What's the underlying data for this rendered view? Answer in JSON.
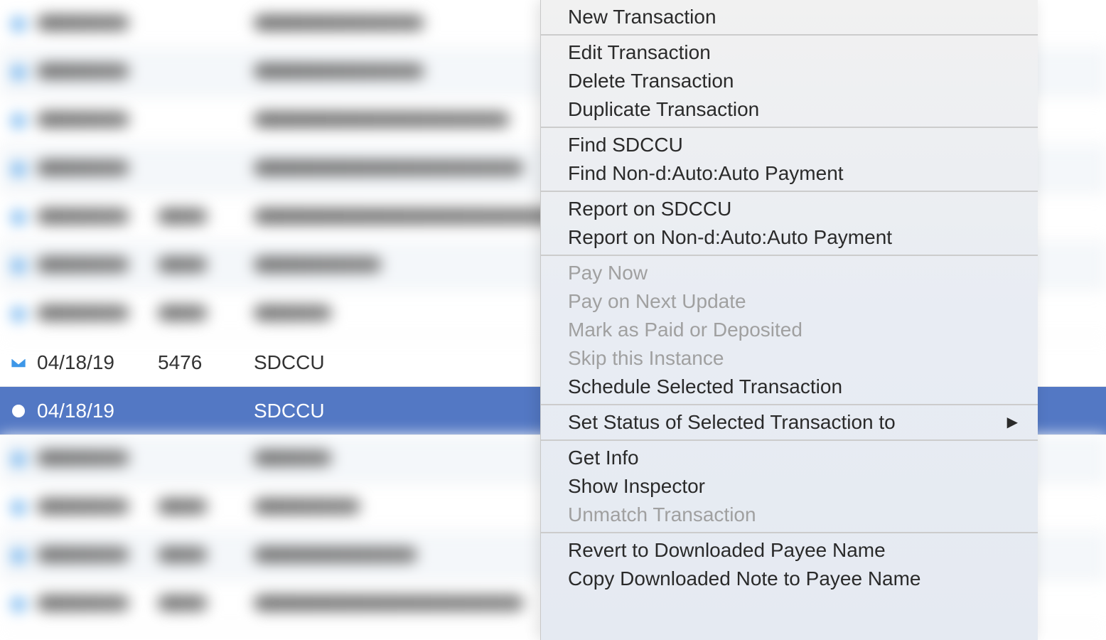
{
  "transactions": {
    "blurred_above": [
      {
        "alt": false,
        "payee_width": 240
      },
      {
        "alt": true,
        "payee_width": 240
      },
      {
        "alt": false,
        "payee_width": 360,
        "has_num": false
      },
      {
        "alt": true,
        "payee_width": 380,
        "has_num": false
      },
      {
        "alt": false,
        "payee_width": 450,
        "has_num": true
      },
      {
        "alt": true,
        "payee_width": 180,
        "has_num": true
      },
      {
        "alt": false,
        "payee_width": 110,
        "has_num": true
      }
    ],
    "focused": [
      {
        "date": "04/18/19",
        "num": "5476",
        "payee": "SDCCU",
        "icon": "envelope",
        "selected": false
      },
      {
        "date": "04/18/19",
        "num": "",
        "payee": "SDCCU",
        "icon": "dot",
        "selected": true
      }
    ],
    "blurred_below": [
      {
        "alt": true,
        "payee_width": 110,
        "has_num": false
      },
      {
        "alt": false,
        "payee_width": 150,
        "has_num": true
      },
      {
        "alt": true,
        "payee_width": 230,
        "has_num": true
      },
      {
        "alt": false,
        "payee_width": 380,
        "has_num": true
      }
    ]
  },
  "menu": {
    "groups": [
      {
        "items": [
          {
            "label": "New Transaction",
            "enabled": true
          }
        ]
      },
      {
        "items": [
          {
            "label": "Edit Transaction",
            "enabled": true
          },
          {
            "label": "Delete Transaction",
            "enabled": true
          },
          {
            "label": "Duplicate Transaction",
            "enabled": true
          }
        ]
      },
      {
        "items": [
          {
            "label": "Find SDCCU",
            "enabled": true
          },
          {
            "label": "Find Non-d:Auto:Auto Payment",
            "enabled": true
          }
        ]
      },
      {
        "items": [
          {
            "label": "Report on SDCCU",
            "enabled": true
          },
          {
            "label": "Report on Non-d:Auto:Auto Payment",
            "enabled": true
          }
        ]
      },
      {
        "items": [
          {
            "label": "Pay Now",
            "enabled": false
          },
          {
            "label": "Pay on Next Update",
            "enabled": false
          },
          {
            "label": "Mark as Paid or Deposited",
            "enabled": false
          },
          {
            "label": "Skip this Instance",
            "enabled": false
          },
          {
            "label": "Schedule Selected Transaction",
            "enabled": true
          }
        ]
      },
      {
        "items": [
          {
            "label": "Set Status of Selected Transaction to",
            "enabled": true,
            "submenu": true
          }
        ]
      },
      {
        "items": [
          {
            "label": "Get Info",
            "enabled": true
          },
          {
            "label": "Show Inspector",
            "enabled": true
          },
          {
            "label": "Unmatch Transaction",
            "enabled": false
          }
        ]
      },
      {
        "items": [
          {
            "label": "Revert to Downloaded Payee Name",
            "enabled": true
          },
          {
            "label": "Copy Downloaded Note to Payee Name",
            "enabled": true
          }
        ]
      }
    ]
  }
}
